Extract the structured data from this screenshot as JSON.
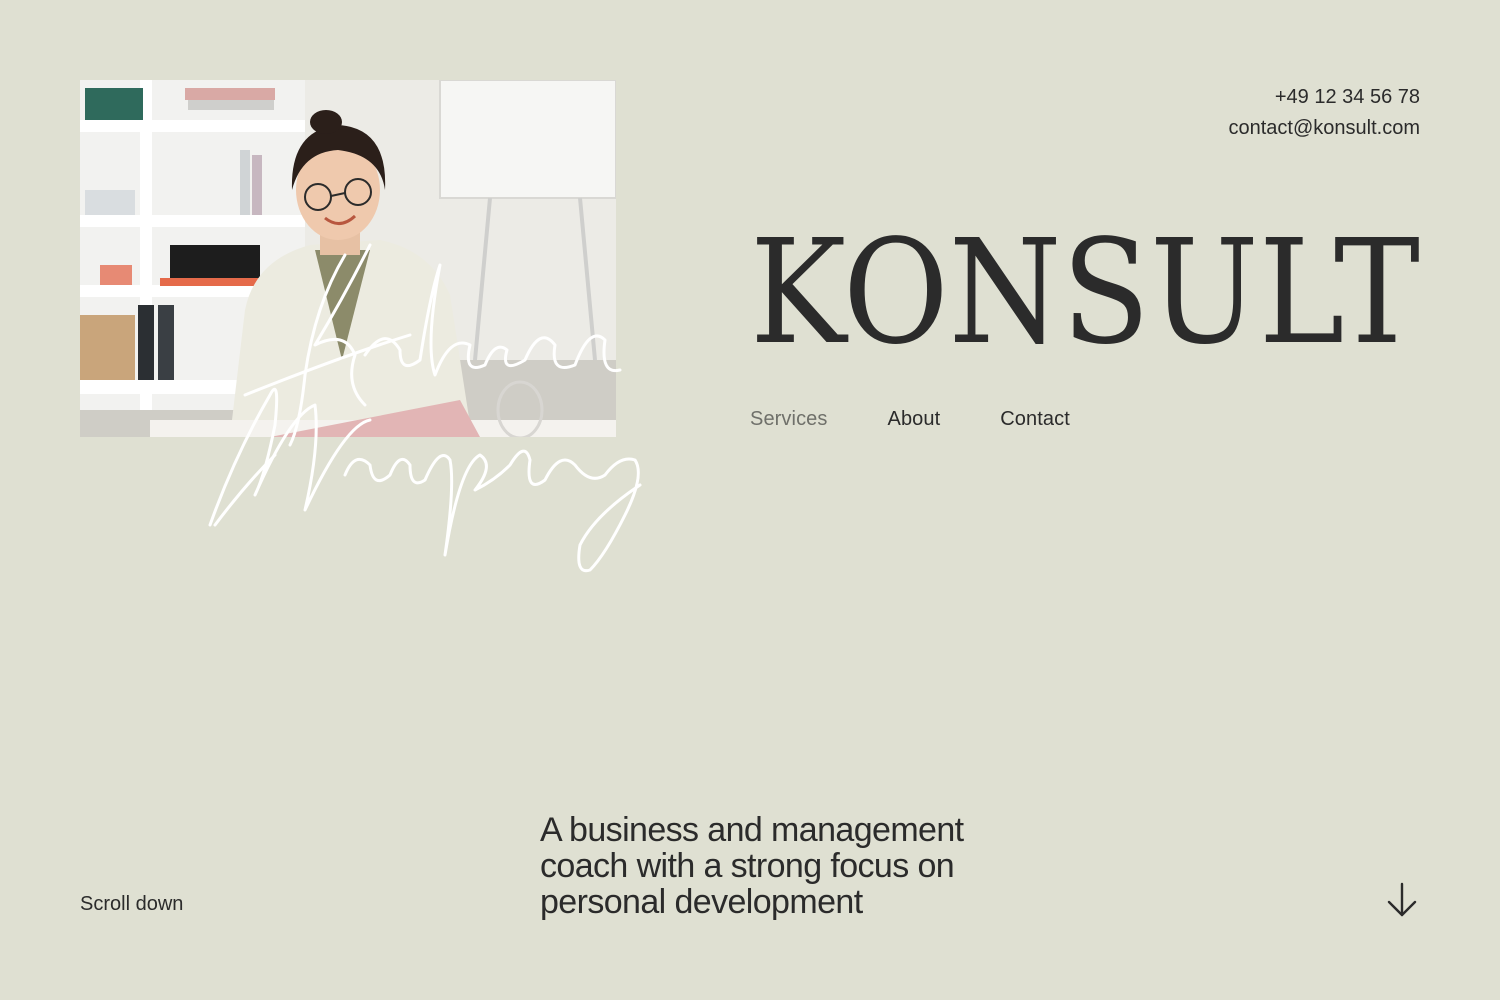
{
  "contact": {
    "phone": "+49 12 34 56 78",
    "email": "contact@konsult.com"
  },
  "brand": {
    "logo_text": "KONSULT"
  },
  "signature": {
    "text": "Kathryn Murphy"
  },
  "nav": {
    "items": [
      {
        "label": "Services",
        "active": false
      },
      {
        "label": "About",
        "active": false
      },
      {
        "label": "Contact",
        "active": false
      }
    ]
  },
  "hero": {
    "tagline": "A business and management coach with a strong focus on personal development",
    "scroll_label": "Scroll down",
    "scroll_icon": "arrow-down-icon"
  },
  "colors": {
    "background": "#dfe0d2",
    "text": "#2b2b2b",
    "muted_text": "#6f706a"
  }
}
